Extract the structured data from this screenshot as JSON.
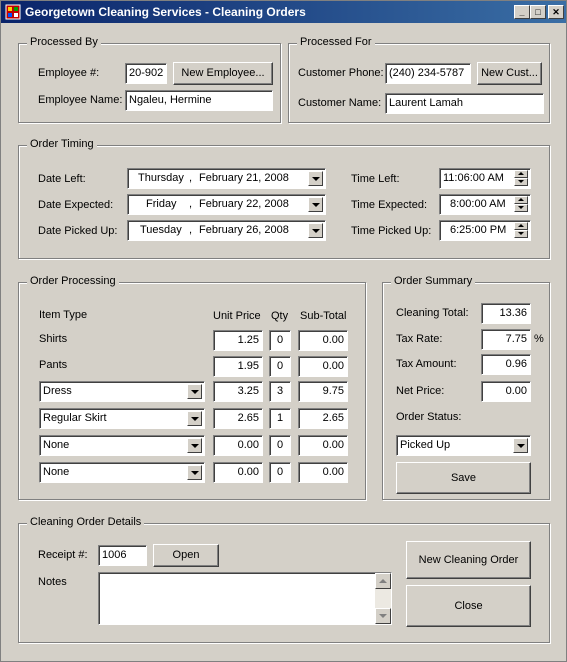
{
  "window": {
    "title": "Georgetown Cleaning Services - Cleaning Orders",
    "min_glyph": "_",
    "max_glyph": "□",
    "close_glyph": "✕"
  },
  "processed_by": {
    "title": "Processed By",
    "employee_number_label": "Employee #:",
    "employee_number": "20-902",
    "new_employee_button": "New Employee...",
    "employee_name_label": "Employee Name:",
    "employee_name": "Ngaleu, Hermine"
  },
  "processed_for": {
    "title": "Processed For",
    "customer_phone_label": "Customer Phone:",
    "customer_phone": "(240) 234-5787",
    "new_customer_button": "New Cust...",
    "customer_name_label": "Customer Name:",
    "customer_name": "Laurent Lamah"
  },
  "order_timing": {
    "title": "Order Timing",
    "date_left": {
      "label": "Date Left:",
      "weekday": "Thursday",
      "month_day": "February  21, 2008"
    },
    "date_expected": {
      "label": "Date Expected:",
      "weekday": "Friday",
      "month_day": "February  22, 2008"
    },
    "date_picked_up": {
      "label": "Date Picked Up:",
      "weekday": "Tuesday",
      "month_day": "February  26, 2008"
    },
    "date_separator": ",",
    "time_left": {
      "label": "Time Left:",
      "value": "11:06:00 AM"
    },
    "time_expected": {
      "label": "Time Expected:",
      "value": "8:00:00 AM"
    },
    "time_picked_up": {
      "label": "Time Picked Up:",
      "value": "6:25:00 PM"
    }
  },
  "order_processing": {
    "title": "Order Processing",
    "headers": {
      "item_type": "Item Type",
      "unit_price": "Unit Price",
      "qty": "Qty",
      "sub_total": "Sub-Total"
    },
    "rows": [
      {
        "item": "Shirts",
        "unit_price": "1.25",
        "qty": "0",
        "sub_total": "0.00"
      },
      {
        "item": "Pants",
        "unit_price": "1.95",
        "qty": "0",
        "sub_total": "0.00"
      },
      {
        "item": "Dress",
        "unit_price": "3.25",
        "qty": "3",
        "sub_total": "9.75"
      },
      {
        "item": "Regular Skirt",
        "unit_price": "2.65",
        "qty": "1",
        "sub_total": "2.65"
      },
      {
        "item": "None",
        "unit_price": "0.00",
        "qty": "0",
        "sub_total": "0.00"
      },
      {
        "item": "None",
        "unit_price": "0.00",
        "qty": "0",
        "sub_total": "0.00"
      }
    ]
  },
  "order_summary": {
    "title": "Order Summary",
    "cleaning_total_label": "Cleaning Total:",
    "cleaning_total": "13.36",
    "tax_rate_label": "Tax Rate:",
    "tax_rate": "7.75",
    "percent_sign": "%",
    "tax_amount_label": "Tax Amount:",
    "tax_amount": "0.96",
    "net_price_label": "Net Price:",
    "net_price": "0.00",
    "order_status_label": "Order Status:",
    "order_status": "Picked Up",
    "save_button": "Save"
  },
  "cleaning_order_details": {
    "title": "Cleaning Order Details",
    "receipt_label": "Receipt #:",
    "receipt_number": "1006",
    "open_button": "Open",
    "notes_label": "Notes",
    "notes": "",
    "new_order_button": "New Cleaning Order",
    "close_button": "Close"
  }
}
